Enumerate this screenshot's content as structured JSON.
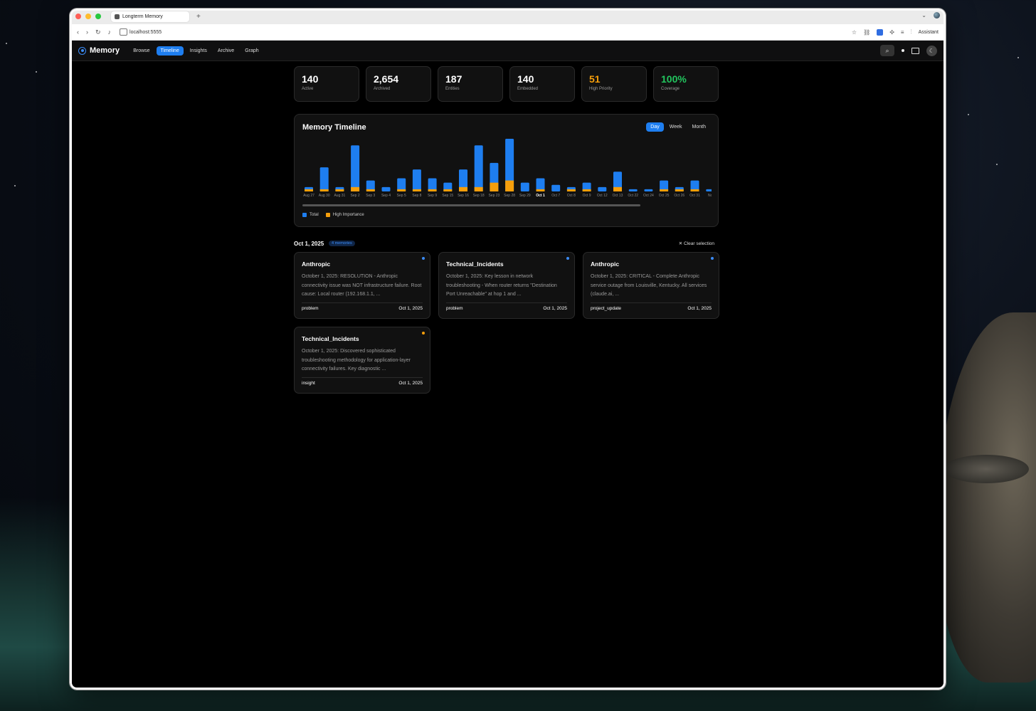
{
  "browser": {
    "tab_title": "Longterm Memory",
    "new_tab": "+",
    "url": "localhost:5555",
    "assistant_label": "Assistant"
  },
  "app": {
    "brand": "Memory",
    "nav": [
      "Browse",
      "Timeline",
      "Insights",
      "Archive",
      "Graph"
    ],
    "active_nav": "Timeline"
  },
  "stats": [
    {
      "value": "140",
      "label": "Active",
      "color": "#ffffff"
    },
    {
      "value": "2,654",
      "label": "Archived",
      "color": "#ffffff"
    },
    {
      "value": "187",
      "label": "Entities",
      "color": "#ffffff"
    },
    {
      "value": "140",
      "label": "Embedded",
      "color": "#ffffff"
    },
    {
      "value": "51",
      "label": "High Priority",
      "color": "#f59e0b"
    },
    {
      "value": "100%",
      "label": "Coverage",
      "color": "#22c55e"
    }
  ],
  "timeline": {
    "title": "Memory Timeline",
    "ranges": [
      "Day",
      "Week",
      "Month"
    ],
    "active_range": "Day",
    "legend": [
      {
        "label": "Total",
        "color": "#1e7ef0"
      },
      {
        "label": "High Importance",
        "color": "#f59e0b"
      }
    ]
  },
  "chart_data": {
    "type": "bar",
    "stacked": true,
    "categories": [
      "Aug 27",
      "Aug 30",
      "Aug 31",
      "Sep 2",
      "Sep 3",
      "Sep 4",
      "Sep 5",
      "Sep 8",
      "Sep 9",
      "Sep 15",
      "Sep 16",
      "Sep 18",
      "Sep 23",
      "Sep 28",
      "Sep 29",
      "Oct 1",
      "Oct 7",
      "Oct 8",
      "Oct 9",
      "Oct 12",
      "Oct 13",
      "Oct 22",
      "Oct 24",
      "Oct 25",
      "Oct 26",
      "Oct 31",
      "No"
    ],
    "series": [
      {
        "name": "Total",
        "values": [
          2,
          11,
          2,
          21,
          5,
          2,
          6,
          10,
          6,
          4,
          10,
          21,
          13,
          24,
          4,
          6,
          3,
          2,
          4,
          2,
          9,
          1,
          1,
          5,
          2,
          5,
          1
        ]
      },
      {
        "name": "High Importance",
        "values": [
          1,
          1,
          1,
          2,
          1,
          0,
          1,
          1,
          1,
          1,
          2,
          2,
          4,
          5,
          0,
          1,
          0,
          1,
          1,
          0,
          2,
          0,
          0,
          1,
          1,
          1,
          0
        ]
      }
    ],
    "highlighted_category": "Oct 1",
    "title": "",
    "xlabel": "",
    "ylabel": ""
  },
  "selection": {
    "date": "Oct 1, 2025",
    "count_badge": "4 memories",
    "clear_label": "Clear selection"
  },
  "cards": [
    {
      "title": "Anthropic",
      "text": "October 1, 2025: RESOLUTION - Anthropic connectivity issue was NOT infrastructure failure. Root cause: Local router (192.168.1.1, ...",
      "tag": "problem",
      "date": "Oct 1, 2025",
      "dot_color": "#3b8bf5"
    },
    {
      "title": "Technical_Incidents",
      "text": "October 1, 2025: Key lesson in network troubleshooting - When router returns \"Destination Port Unreachable\" at hop 1 and ...",
      "tag": "problem",
      "date": "Oct 1, 2025",
      "dot_color": "#3b8bf5"
    },
    {
      "title": "Anthropic",
      "text": "October 1, 2025: CRITICAL - Complete Anthropic service outage from Louisville, Kentucky. All services (claude.ai, ...",
      "tag": "project_update",
      "date": "Oct 1, 2025",
      "dot_color": "#3b8bf5"
    },
    {
      "title": "Technical_Incidents",
      "text": "October 1, 2025: Discovered sophisticated troubleshooting methodology for application-layer connectivity failures. Key diagnostic ...",
      "tag": "insight",
      "date": "Oct 1, 2025",
      "dot_color": "#f59e0b"
    }
  ]
}
